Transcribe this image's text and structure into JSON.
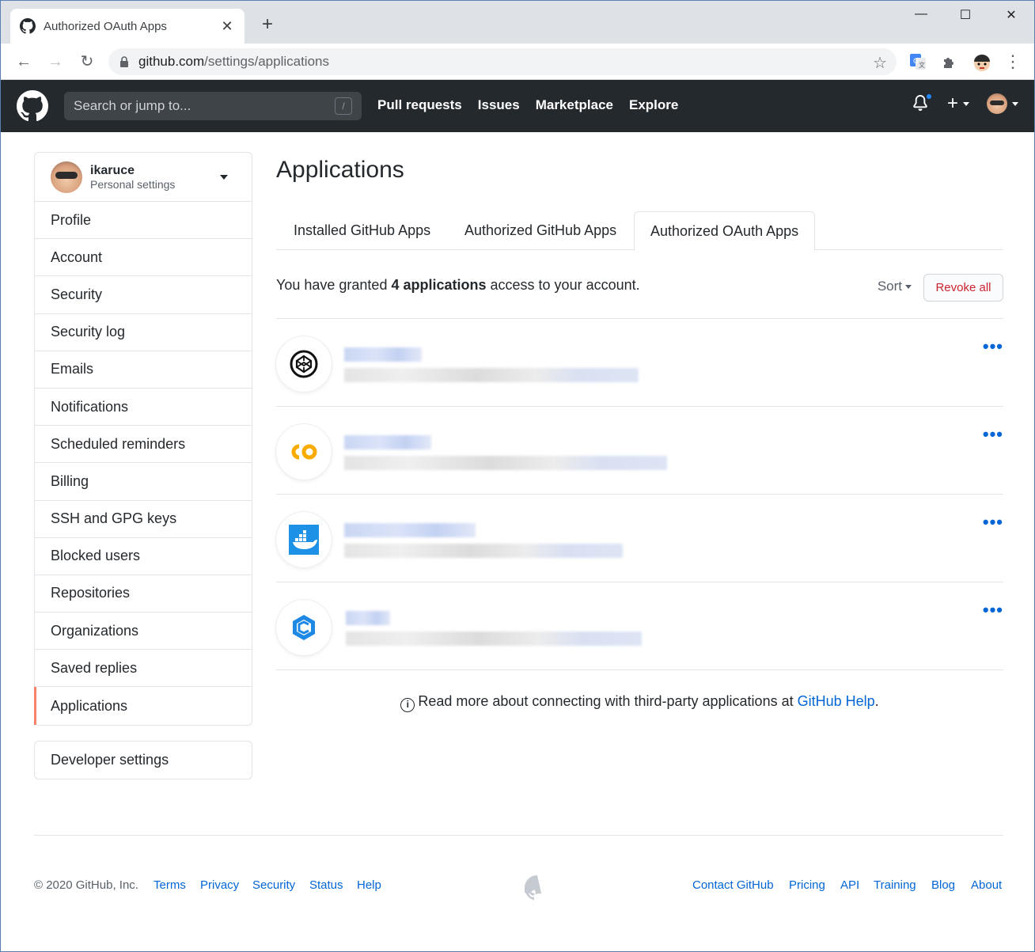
{
  "browser": {
    "tab_title": "Authorized OAuth Apps",
    "tab_close": "✕",
    "new_tab": "+",
    "url_host": "github.com",
    "url_path": "/settings/applications",
    "window_minimize": "—",
    "window_maximize": "☐",
    "window_close": "✕"
  },
  "header": {
    "search_placeholder": "Search or jump to...",
    "search_shortcut": "/",
    "nav": [
      "Pull requests",
      "Issues",
      "Marketplace",
      "Explore"
    ]
  },
  "sidebar": {
    "username": "ikaruce",
    "subtitle": "Personal settings",
    "items": [
      "Profile",
      "Account",
      "Security",
      "Security log",
      "Emails",
      "Notifications",
      "Scheduled reminders",
      "Billing",
      "SSH and GPG keys",
      "Blocked users",
      "Repositories",
      "Organizations",
      "Saved replies",
      "Applications"
    ],
    "selected": "Applications",
    "developer_settings": "Developer settings"
  },
  "main": {
    "title": "Applications",
    "tabs": [
      "Installed GitHub Apps",
      "Authorized GitHub Apps",
      "Authorized OAuth Apps"
    ],
    "selected_tab": "Authorized OAuth Apps",
    "granted_prefix": "You have granted ",
    "granted_count": "4 applications",
    "granted_suffix": " access to your account.",
    "sort_label": "Sort",
    "revoke_all": "Revoke all",
    "apps": [
      {
        "icon": "codepen-icon",
        "more": "•••"
      },
      {
        "icon": "colab-icon",
        "more": "•••"
      },
      {
        "icon": "docker-icon",
        "more": "•••"
      },
      {
        "icon": "codeship-icon",
        "more": "•••"
      }
    ],
    "readmore_text": "Read more about connecting with third-party applications at ",
    "readmore_link": "GitHub Help",
    "readmore_end": "."
  },
  "footer": {
    "copyright": "© 2020 GitHub, Inc.",
    "left_links": [
      "Terms",
      "Privacy",
      "Security",
      "Status",
      "Help"
    ],
    "right_links": [
      "Contact GitHub",
      "Pricing",
      "API",
      "Training",
      "Blog",
      "About"
    ]
  },
  "colors": {
    "header_bg": "#24292e",
    "link": "#0366d6",
    "danger": "#cb2431",
    "selected_accent": "#f9826c"
  }
}
